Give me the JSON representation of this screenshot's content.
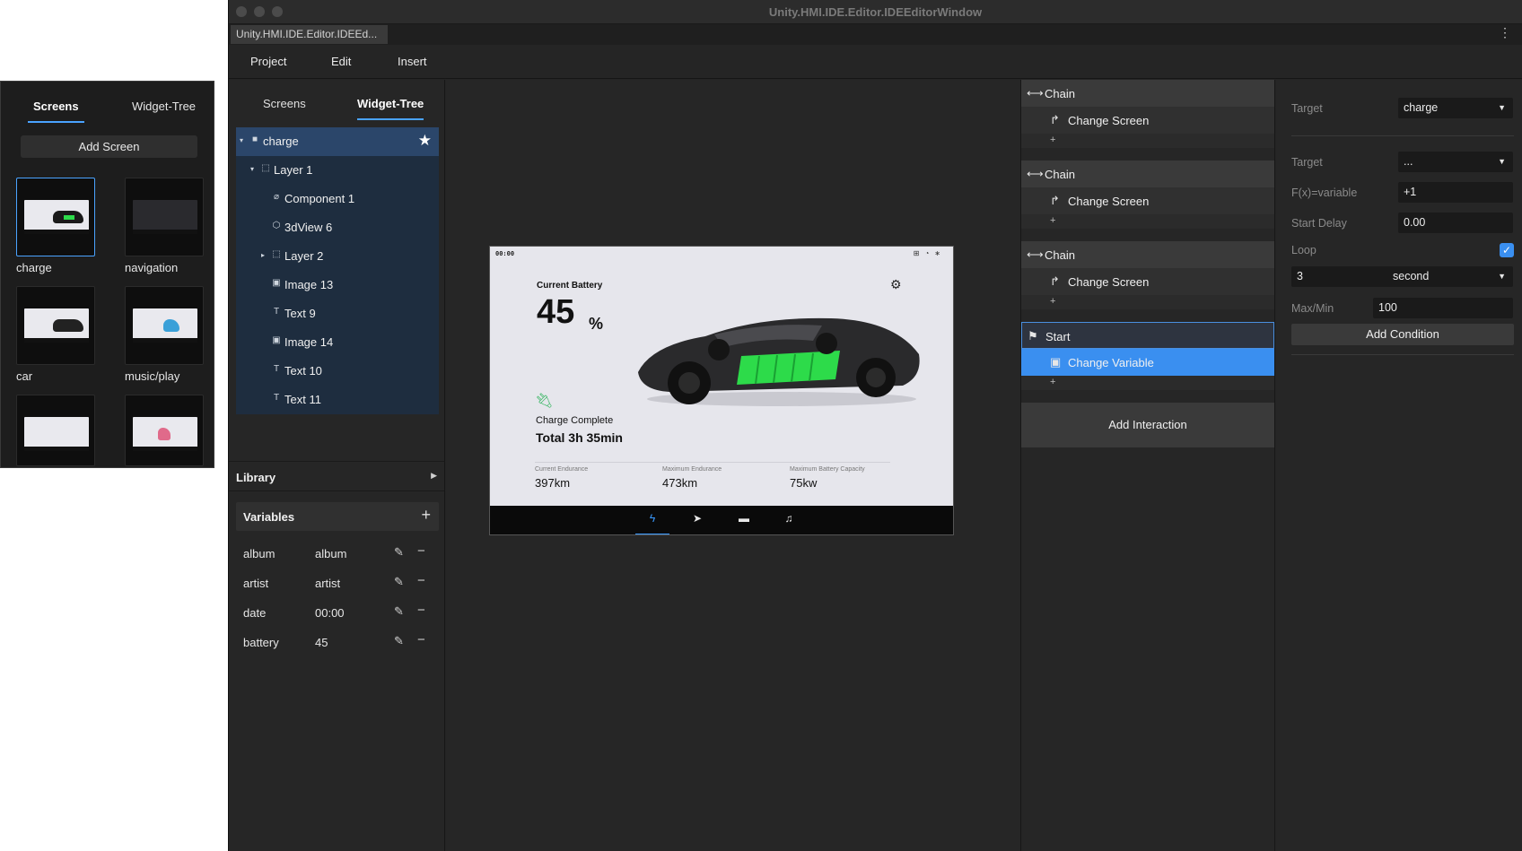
{
  "float_panel": {
    "tabs": [
      "Screens",
      "Widget-Tree"
    ],
    "add_screen": "Add Screen",
    "screens": [
      {
        "label": "charge"
      },
      {
        "label": "navigation"
      },
      {
        "label": "car"
      },
      {
        "label": "music/play"
      },
      {
        "label": ""
      },
      {
        "label": ""
      }
    ]
  },
  "window": {
    "title": "Unity.HMI.IDE.Editor.IDEEditorWindow",
    "doc_tab": "Unity.HMI.IDE.Editor.IDEEd...",
    "more": "⋮"
  },
  "menu": [
    "Project",
    "Edit",
    "Insert"
  ],
  "left": {
    "tabs": [
      "Screens",
      "Widget-Tree"
    ],
    "tree": [
      {
        "label": "charge",
        "icon": "■",
        "caret": "▾",
        "indent": 0,
        "starred": true
      },
      {
        "label": "Layer 1",
        "icon": "⬚",
        "caret": "▾",
        "indent": 1
      },
      {
        "label": "Component 1",
        "icon": "⌀",
        "caret": "",
        "indent": 2
      },
      {
        "label": "3dView 6",
        "icon": "⬡",
        "caret": "",
        "indent": 2
      },
      {
        "label": "Layer 2",
        "icon": "⬚",
        "caret": "▸",
        "indent": 2
      },
      {
        "label": "Image 13",
        "icon": "▣",
        "caret": "",
        "indent": 2
      },
      {
        "label": "Text 9",
        "icon": "T",
        "caret": "",
        "indent": 2
      },
      {
        "label": "Image 14",
        "icon": "▣",
        "caret": "",
        "indent": 2
      },
      {
        "label": "Text 10",
        "icon": "T",
        "caret": "",
        "indent": 2
      },
      {
        "label": "Text 11",
        "icon": "T",
        "caret": "",
        "indent": 2
      }
    ],
    "library": "Library",
    "variables_title": "Variables",
    "variables": [
      {
        "name": "album",
        "value": "album"
      },
      {
        "name": "artist",
        "value": "artist"
      },
      {
        "name": "date",
        "value": "00:00"
      },
      {
        "name": "battery",
        "value": "45"
      }
    ]
  },
  "screen": {
    "clock": "00:00",
    "current_battery_label": "Current Battery",
    "battery_value": "45",
    "battery_unit": "%",
    "charge_complete_label": "Charge Complete",
    "total_time": "Total 3h 35min",
    "stats": [
      {
        "label": "Current Endurance",
        "value": "397km"
      },
      {
        "label": "Maximum Endurance",
        "value": "473km"
      },
      {
        "label": "Maximum Battery Capacity",
        "value": "75kw"
      }
    ],
    "battery_color": "#2ddb4a",
    "accent_color": "#3a9bff"
  },
  "interactions": {
    "groups": [
      {
        "header": "Chain",
        "action": "Change Screen"
      },
      {
        "header": "Chain",
        "action": "Change Screen"
      },
      {
        "header": "Chain",
        "action": "Change Screen"
      },
      {
        "header": "Start",
        "action": "Change Variable"
      }
    ],
    "plus": "+",
    "add_interaction": "Add Interaction"
  },
  "props": {
    "target1_label": "Target",
    "target1_value": "charge",
    "target2_label": "Target",
    "target2_value": "...",
    "fx_label": "F(x)=variable",
    "fx_value": "+1",
    "start_delay_label": "Start Delay",
    "start_delay_value": "0.00",
    "loop_label": "Loop",
    "loop_checked": true,
    "loop_count": "3",
    "loop_unit": "second",
    "maxmin_label": "Max/Min",
    "maxmin_value": "100",
    "add_condition": "Add Condition"
  }
}
